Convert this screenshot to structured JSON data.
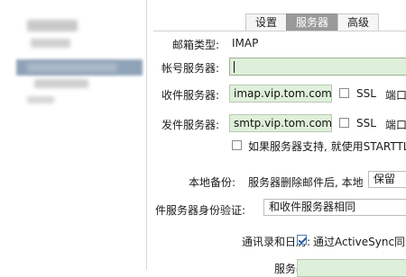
{
  "tabs": [
    "设置",
    "服务器",
    "高级"
  ],
  "active_tab": 1,
  "account_type": {
    "label": "邮箱类型:",
    "value": "IMAP"
  },
  "account_server": {
    "label": "帐号服务器:",
    "value": ""
  },
  "incoming": {
    "label": "收件服务器:",
    "value": "imap.vip.tom.com",
    "ssl": "SSL",
    "port_label": "端口"
  },
  "outgoing": {
    "label": "发件服务器:",
    "value": "smtp.vip.tom.com",
    "ssl": "SSL",
    "port_label": "端口"
  },
  "starttls": {
    "label": "如果服务器支持, 就使用STARTTL"
  },
  "local_backup": {
    "label": "本地备份:",
    "text": "服务器删除邮件后, 本地",
    "value": "保留"
  },
  "outgoing_auth": {
    "label": "件服务器身份验证:",
    "value": "和收件服务器相同"
  },
  "contacts_calendar": {
    "label": "通讯录和日历:",
    "option": "通过ActiveSync同步"
  },
  "server": {
    "label": "服务器:"
  },
  "colors": {
    "field_bg": "#dff0da",
    "active_tab": "#9a9a9a"
  }
}
